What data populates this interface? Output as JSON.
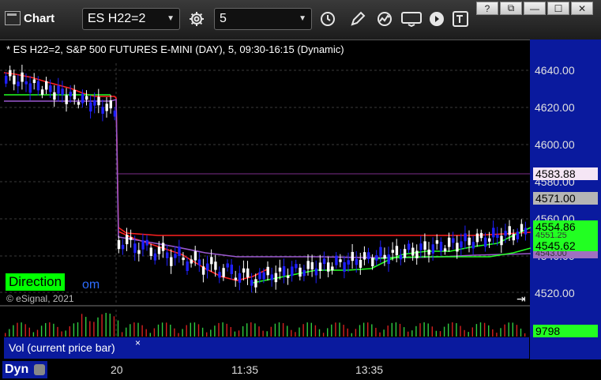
{
  "toolbar": {
    "title": "Chart",
    "symbol": "ES H22=2",
    "interval": "5"
  },
  "window_buttons": [
    "?",
    "⧉",
    "—",
    "☐",
    "✕"
  ],
  "chart": {
    "info": "* ES H22=2, S&P 500 FUTURES E-MINI (DAY), 5, 09:30-16:15 (Dynamic)",
    "direction_label": "Direction",
    "direction_suffix": "om",
    "copyright": "© eSignal, 2021",
    "price_ticks": [
      "4640.00",
      "4620.00",
      "4600.00",
      "4580.00",
      "4560.00",
      "4540.00",
      "4520.00"
    ],
    "tags": {
      "purple": "4583.88",
      "gray": "4571.00",
      "green_top": "4554.86",
      "hidden1": "4551.25",
      "green_bottom": "4545.62",
      "purple_bottom": "4543.00"
    },
    "colors": {
      "up": "#ffffff",
      "down": "#1f1fff",
      "red_line": "#ff2020",
      "green_line": "#22ff22",
      "purple_line": "#9b59d0",
      "axis_bg": "#0a1a9e"
    }
  },
  "volume": {
    "label": "Vol (current price bar)",
    "value": "9798",
    "close": "×"
  },
  "bottom": {
    "dyn": "Dyn",
    "times": [
      "20",
      "11:35",
      "13:35"
    ]
  }
}
